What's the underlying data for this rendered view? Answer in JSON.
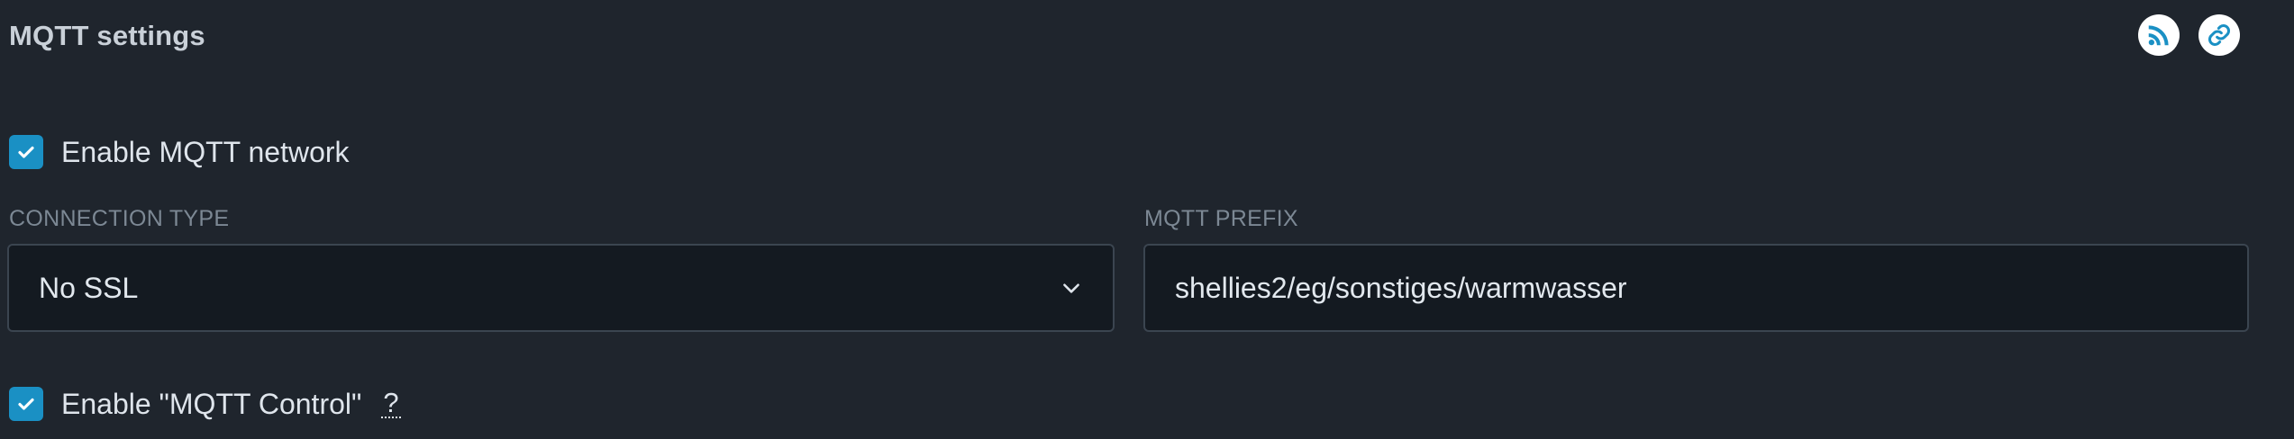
{
  "header": {
    "title": "MQTT settings",
    "actions": [
      {
        "icon": "rss-icon",
        "color": "#1a90c4"
      },
      {
        "icon": "link-icon",
        "color": "#1a90c4"
      }
    ]
  },
  "enable_network": {
    "label": "Enable MQTT network",
    "checked": true
  },
  "connection_type": {
    "label": "CONNECTION TYPE",
    "selected": "No SSL"
  },
  "mqtt_prefix": {
    "label": "MQTT PREFIX",
    "value": "shellies2/eg/sonstiges/warmwasser"
  },
  "enable_control": {
    "label": "Enable \"MQTT Control\"",
    "checked": true,
    "help": "?"
  },
  "colors": {
    "background": "#1f252d",
    "accent": "#1a90c4",
    "field_background": "#141a21"
  }
}
